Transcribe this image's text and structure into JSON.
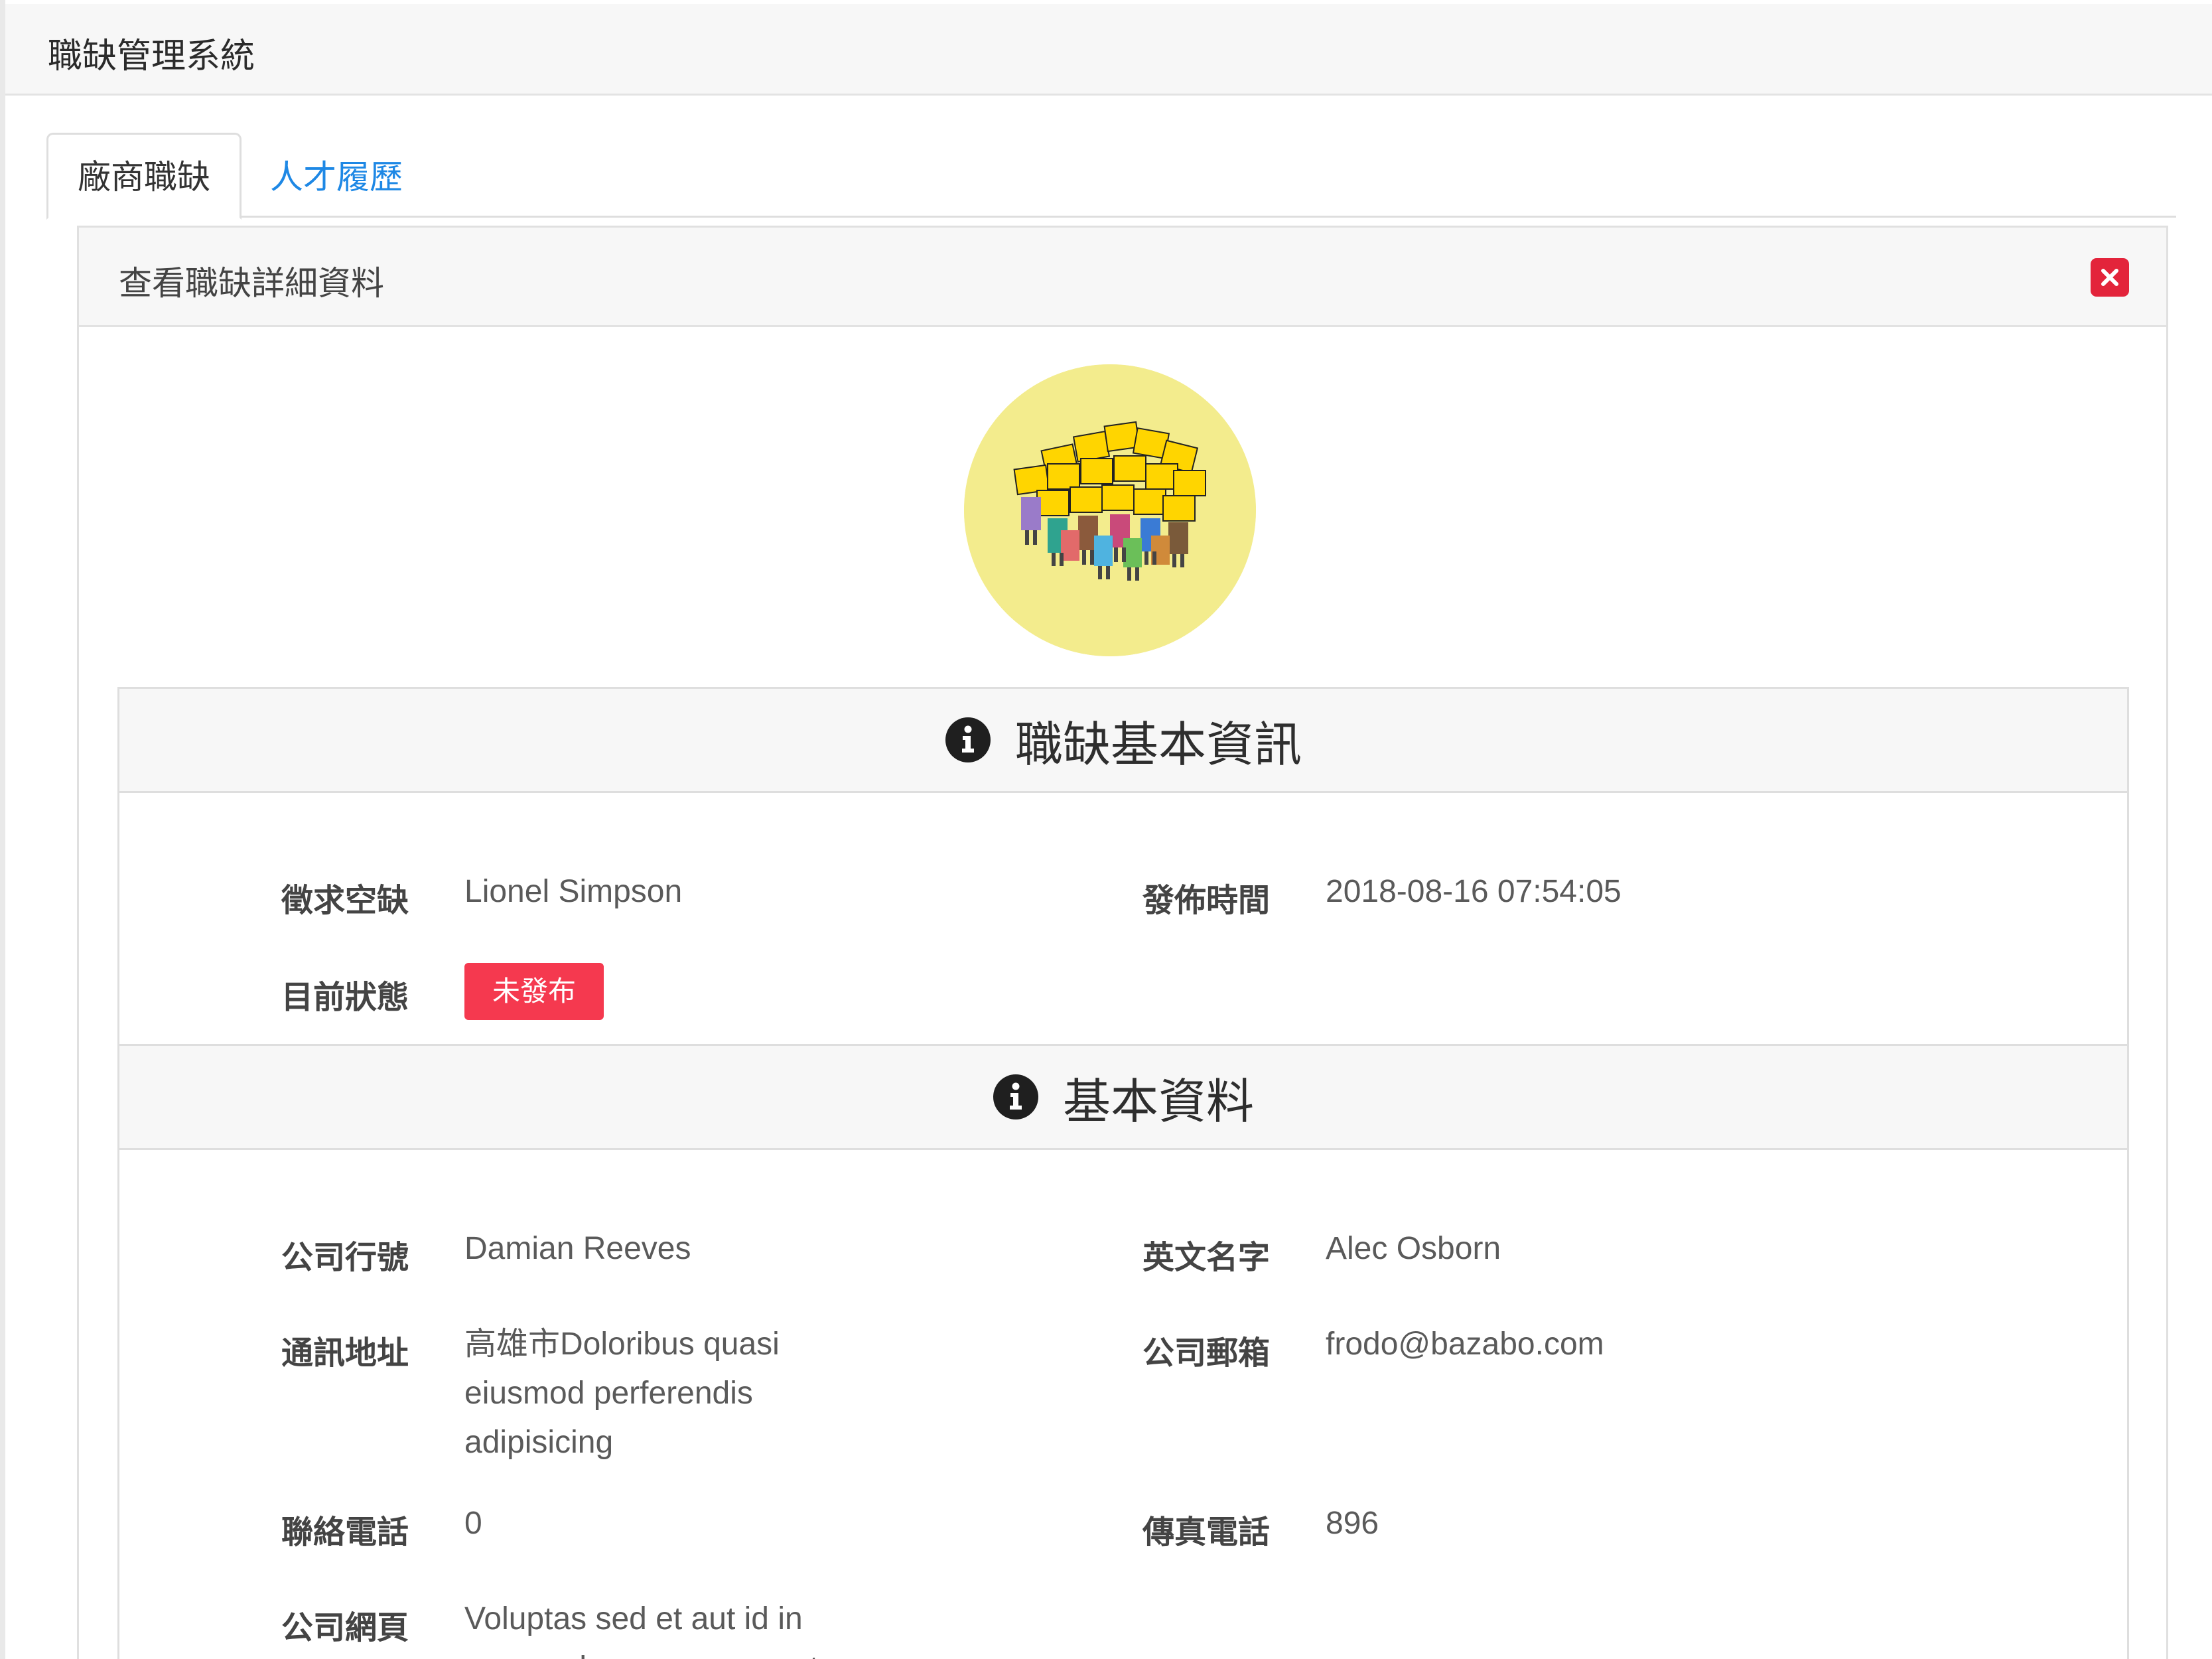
{
  "app": {
    "title": "職缺管理系統"
  },
  "tabs": [
    {
      "label": "廠商職缺",
      "active": true
    },
    {
      "label": "人才履歷",
      "active": false
    }
  ],
  "panel": {
    "title": "查看職缺詳細資料",
    "close_icon": "close-icon"
  },
  "job_section": {
    "title": "職缺基本資訊",
    "icon": "info-circle-icon",
    "fields": {
      "position_label": "徵求空缺",
      "position_value": "Lionel Simpson",
      "published_label": "發佈時間",
      "published_value": "2018-08-16 07:54:05",
      "status_label": "目前狀態",
      "status_value": "未發布"
    }
  },
  "basic_section": {
    "title": "基本資料",
    "icon": "info-circle-icon",
    "fields": {
      "company_label": "公司行號",
      "company_value": "Damian Reeves",
      "english_label": "英文名字",
      "english_value": "Alec Osborn",
      "address_label": "通訊地址",
      "address_lines": [
        "高雄市Doloribus quasi",
        "eiusmod perferendis",
        "adipisicing"
      ],
      "email_label": "公司郵箱",
      "email_value": "frodo@bazabo.com",
      "phone_label": "聯絡電話",
      "phone_value": "0",
      "fax_label": "傳真電話",
      "fax_value": "896",
      "website_label": "公司網頁",
      "website_lines": [
        "Voluptas sed et aut id in",
        "commodo non porro sunt"
      ]
    }
  },
  "colors": {
    "accent": "#1e88e5",
    "danger": "#e3243b",
    "badge": "#f5394f",
    "avatar_bg": "#f3ec8d"
  }
}
